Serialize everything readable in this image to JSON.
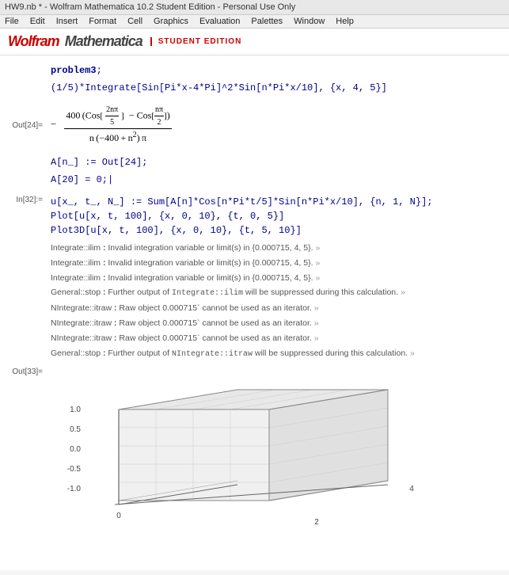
{
  "window": {
    "title": "HW9.nb * - Wolfram Mathematica 10.2 Student Edition - Personal Use Only"
  },
  "menu": {
    "items": [
      "File",
      "Edit",
      "Insert",
      "Format",
      "Cell",
      "Graphics",
      "Evaluation",
      "Palettes",
      "Window",
      "Help"
    ]
  },
  "logo": {
    "wolfram": "Wolfram",
    "mathematica": "Mathematica",
    "edition": "Student Edition"
  },
  "cells": {
    "problem_label": "problem3",
    "input_line1": "(1/5)*Integrate[Sin[Pi*x-4*Pi]^2*Sin[n*Pi*x/10], {x, 4, 5}]",
    "out24_label": "Out[24]=",
    "out24_minus": "-",
    "out24_numerator": "400 (Cos[2nπ/5] - Cos[nπ/2])",
    "out24_denominator": "n (-400 + n²) π",
    "assign1": "A[n_] := Out[24];",
    "assign2": "A[20] = 0;",
    "in32_label": "In[32]:=",
    "in32_line1": "u[x_, t_, N_] := Sum[A[n]*Cos[n*Pi*t/5]*Sin[n*Pi*x/10], {n, 1, N}];",
    "in32_line2": "Plot[u[x, t, 100], {x, 0, 10}, {t, 0, 5}]",
    "in32_line3": "Plot3D[u[x, t, 100], {x, 0, 10}, {t, 5, 10}]",
    "messages": [
      {
        "source": "Integrate::ilim",
        "colon": " : ",
        "text": "Invalid integration variable or limit(s) in {0.000715, 4, 5}.",
        "link": " »"
      },
      {
        "source": "Integrate::ilim",
        "colon": " : ",
        "text": "Invalid integration variable or limit(s) in {0.000715, 4, 5}.",
        "link": " »"
      },
      {
        "source": "Integrate::ilim",
        "colon": " : ",
        "text": "Invalid integration variable or limit(s) in {0.000715, 4, 5}.",
        "link": " »"
      },
      {
        "source": "General::stop",
        "colon": " : ",
        "text": "Further output of Integrate::ilim will be suppressed during this calculation.",
        "link": " »"
      },
      {
        "source": "NIntegrate::itraw",
        "colon": " : ",
        "text": "Raw object 0.000715` cannot be used as an iterator.",
        "link": " »"
      },
      {
        "source": "NIntegrate::itraw",
        "colon": " : ",
        "text": "Raw object 0.000715` cannot be used as an iterator.",
        "link": " »"
      },
      {
        "source": "NIntegrate::itraw",
        "colon": " : ",
        "text": "Raw object 0.000715` cannot be used as an iterator.",
        "link": " »"
      },
      {
        "source": "General::stop",
        "colon": " : ",
        "text": "Further output of NIntegrate::itraw will be suppressed during this calculation.",
        "link": " »"
      }
    ],
    "out33_label": "Out[33]="
  }
}
